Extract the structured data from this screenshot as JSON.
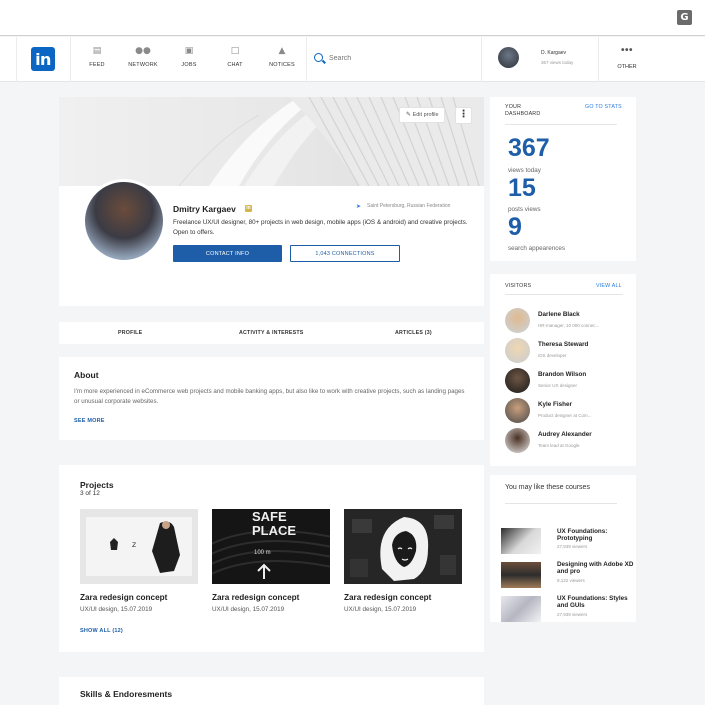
{
  "browser": {
    "translate_icon": "G"
  },
  "nav": {
    "logo": "in",
    "items": [
      {
        "label": "FEED",
        "icon": "feed-icon"
      },
      {
        "label": "NETWORK",
        "icon": "network-icon"
      },
      {
        "label": "JOBS",
        "icon": "jobs-icon"
      },
      {
        "label": "CHAT",
        "icon": "chat-icon"
      },
      {
        "label": "NOTICES",
        "icon": "bell-icon"
      }
    ],
    "search_placeholder": "Search",
    "user_name": "D. Kargaev",
    "user_views": "367 views today",
    "other_label": "OTHER"
  },
  "profile": {
    "edit_label": "Edit profile",
    "name": "Dmitry Kargaev",
    "badge": "in",
    "location": "Saint Petersburg, Russian Federation",
    "bio": "Freelance UX/UI designer, 80+ projects in web design, mobile apps (iOS & android) and creative projects. Open to offers.",
    "contact_label": "CONTACT INFO",
    "connections_label": "1,043 CONNECTIONS"
  },
  "tabs": [
    "PROFILE",
    "ACTIVITY & INTERESTS",
    "ARTICLES (3)"
  ],
  "about": {
    "title": "About",
    "text": "I'm more experienced in eCommerce web projects and mobile banking apps, but also like to work with creative projects, such as landing pages or unusual corporate websites.",
    "see_more": "SEE MORE"
  },
  "projects": {
    "title": "Projects",
    "count": "3 of 12",
    "items": [
      {
        "title": "Zara redesign concept",
        "meta": "UX/UI design, 15.07.2019"
      },
      {
        "title": "Zara redesign concept",
        "meta": "UX/UI design, 15.07.2019",
        "image_text": [
          "SAFE",
          "PLACE",
          "100 m"
        ]
      },
      {
        "title": "Zara redesign concept",
        "meta": "UX/UI design, 15.07.2019"
      }
    ],
    "show_all": "SHOW ALL (12)"
  },
  "skills": {
    "title": "Skills & Endoresments"
  },
  "dashboard": {
    "title_line1": "YOUR",
    "title_line2": "DASHBOARD",
    "link": "GO TO STATS",
    "stats": [
      {
        "value": "367",
        "label": "views today"
      },
      {
        "value": "15",
        "label": "posts views"
      },
      {
        "value": "9",
        "label": "search appearences"
      }
    ]
  },
  "visitors": {
    "title": "VISITORS",
    "link": "VIEW ALL",
    "items": [
      {
        "name": "Darlene Black",
        "role": "HR-manager, 10 000 connec..."
      },
      {
        "name": "Theresa Steward",
        "role": "iOS developer"
      },
      {
        "name": "Brandon Wilson",
        "role": "Senior UX designer"
      },
      {
        "name": "Kyle Fisher",
        "role": "Product designer at Com..."
      },
      {
        "name": "Audrey Alexander",
        "role": "Team lead at Google"
      }
    ]
  },
  "courses": {
    "title": "You may like these courses",
    "items": [
      {
        "title": "UX Foundations: Prototyping",
        "meta": "27,939 viewers"
      },
      {
        "title": "Designing with Adobe XD and pro",
        "meta": "9,122 viewers"
      },
      {
        "title": "UX Foundations: Styles and GUIs",
        "meta": "27,939 viewers"
      }
    ]
  },
  "colors": {
    "accent": "#1e5ea8",
    "brand": "#0a66c2",
    "link": "#2a7be4"
  }
}
